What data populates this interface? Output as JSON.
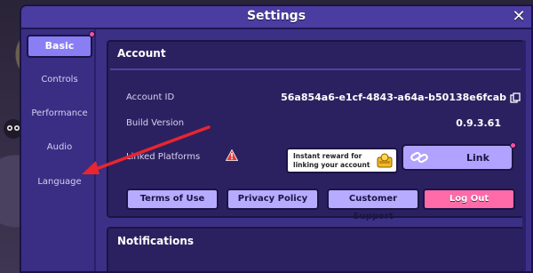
{
  "modal": {
    "title": "Settings",
    "close_glyph": "✕"
  },
  "sidebar": {
    "items": [
      {
        "label": "Basic",
        "active": true
      },
      {
        "label": "Controls",
        "active": false
      },
      {
        "label": "Performance",
        "active": false
      },
      {
        "label": "Audio",
        "active": false
      },
      {
        "label": "Language",
        "active": false
      }
    ]
  },
  "account": {
    "title": "Account",
    "account_id_label": "Account ID",
    "account_id_value": "56a854a6-e1cf-4843-a64a-b50138e6fcab",
    "build_label": "Build Version",
    "build_value": "0.9.3.61",
    "linked_label": "Linked Platforms",
    "tooltip_line1": "Instant reward for",
    "tooltip_line2": "linking your account",
    "link_button": "Link",
    "buttons": {
      "terms": "Terms of Use",
      "privacy": "Privacy Policy",
      "support": "Customer Support",
      "logout": "Log Out"
    }
  },
  "notifications": {
    "title": "Notifications"
  },
  "icons": {
    "copy": "copy-icon",
    "warning": "warning-icon",
    "reward": "coin-reward-icon",
    "link": "link-icon",
    "close": "close-icon"
  },
  "colors": {
    "panel": "#3c2f86",
    "accent": "#b1a2ff",
    "logout": "#ff6ba8",
    "warning": "#e53935",
    "annotation_arrow": "#e8262e"
  }
}
